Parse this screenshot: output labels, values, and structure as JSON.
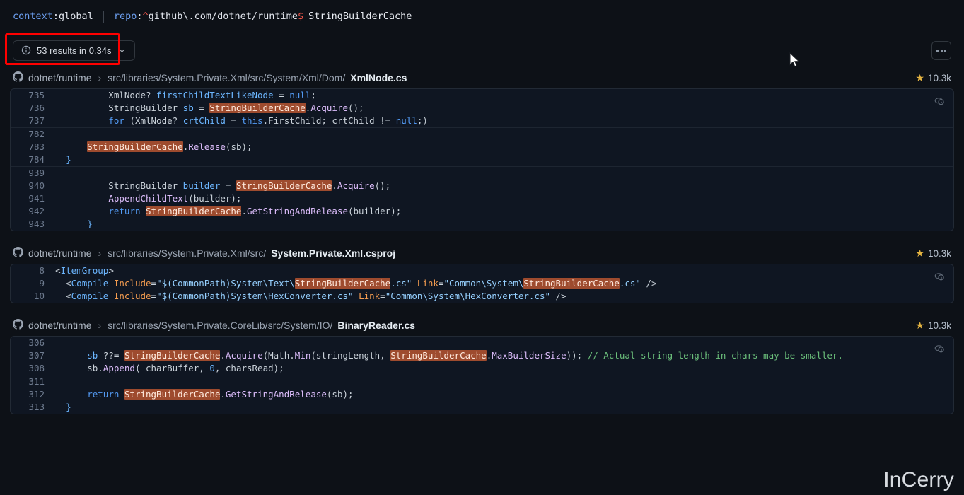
{
  "query": {
    "context_key": "context",
    "context_sep": ":",
    "context_value": "global",
    "repo_key": "repo",
    "repo_sep": ":",
    "repo_regex_start": "^",
    "repo_path": "github\\.com/dotnet/runtime",
    "repo_regex_end": "$",
    "search_term": "StringBuilderCache"
  },
  "toolbar": {
    "results_label": "53 results in 0.34s",
    "info_icon": "info-icon",
    "chevron_icon": "chevron-down-icon",
    "kebab_label": "more-options"
  },
  "watermark": "InCerry",
  "results": [
    {
      "repo": "dotnet/runtime",
      "separator": "›",
      "path_prefix": "src/libraries/System.Private.Xml/src/System/Xml/Dom/",
      "file_name": "XmlNode.cs",
      "stars": "10.3k",
      "star_icon": "star-icon",
      "peek_icon": "code-preview-icon",
      "hunks": [
        {
          "lines": [
            {
              "no": "735",
              "code": "            XmlNode? firstChildTextLikeNode = null;"
            },
            {
              "no": "736",
              "code": "            StringBuilder sb = StringBuilderCache.Acquire();"
            },
            {
              "no": "737",
              "code": "            for (XmlNode? crtChild = this.FirstChild; crtChild != null;)"
            }
          ]
        },
        {
          "lines": [
            {
              "no": "782",
              "code": ""
            },
            {
              "no": "783",
              "code": "        StringBuilderCache.Release(sb);"
            },
            {
              "no": "784",
              "code": "    }"
            }
          ]
        },
        {
          "lines": [
            {
              "no": "939",
              "code": ""
            },
            {
              "no": "940",
              "code": "            StringBuilder builder = StringBuilderCache.Acquire();"
            },
            {
              "no": "941",
              "code": "            AppendChildText(builder);"
            },
            {
              "no": "942",
              "code": "            return StringBuilderCache.GetStringAndRelease(builder);"
            },
            {
              "no": "943",
              "code": "        }"
            }
          ]
        }
      ]
    },
    {
      "repo": "dotnet/runtime",
      "separator": "›",
      "path_prefix": "src/libraries/System.Private.Xml/src/",
      "file_name": "System.Private.Xml.csproj",
      "stars": "10.3k",
      "star_icon": "star-icon",
      "peek_icon": "code-preview-icon",
      "hunks": [
        {
          "lines": [
            {
              "no": "8",
              "code": "  <ItemGroup>"
            },
            {
              "no": "9",
              "code": "    <Compile Include=\"$(CommonPath)System\\Text\\StringBuilderCache.cs\" Link=\"Common\\System\\StringBuilderCache.cs\" />"
            },
            {
              "no": "10",
              "code": "    <Compile Include=\"$(CommonPath)System\\HexConverter.cs\" Link=\"Common\\System\\HexConverter.cs\" />"
            }
          ]
        }
      ]
    },
    {
      "repo": "dotnet/runtime",
      "separator": "›",
      "path_prefix": "src/libraries/System.Private.CoreLib/src/System/IO/",
      "file_name": "BinaryReader.cs",
      "stars": "10.3k",
      "star_icon": "star-icon",
      "peek_icon": "code-preview-icon",
      "hunks": [
        {
          "lines": [
            {
              "no": "306",
              "code": ""
            },
            {
              "no": "307",
              "code": "        sb ??= StringBuilderCache.Acquire(Math.Min(stringLength, StringBuilderCache.MaxBuilderSize)); // Actual string length in chars may be smaller."
            },
            {
              "no": "308",
              "code": "        sb.Append(_charBuffer, 0, charsRead);"
            }
          ]
        },
        {
          "lines": [
            {
              "no": "311",
              "code": ""
            },
            {
              "no": "312",
              "code": "        return StringBuilderCache.GetStringAndRelease(sb);"
            },
            {
              "no": "313",
              "code": "    }"
            }
          ]
        }
      ]
    }
  ]
}
